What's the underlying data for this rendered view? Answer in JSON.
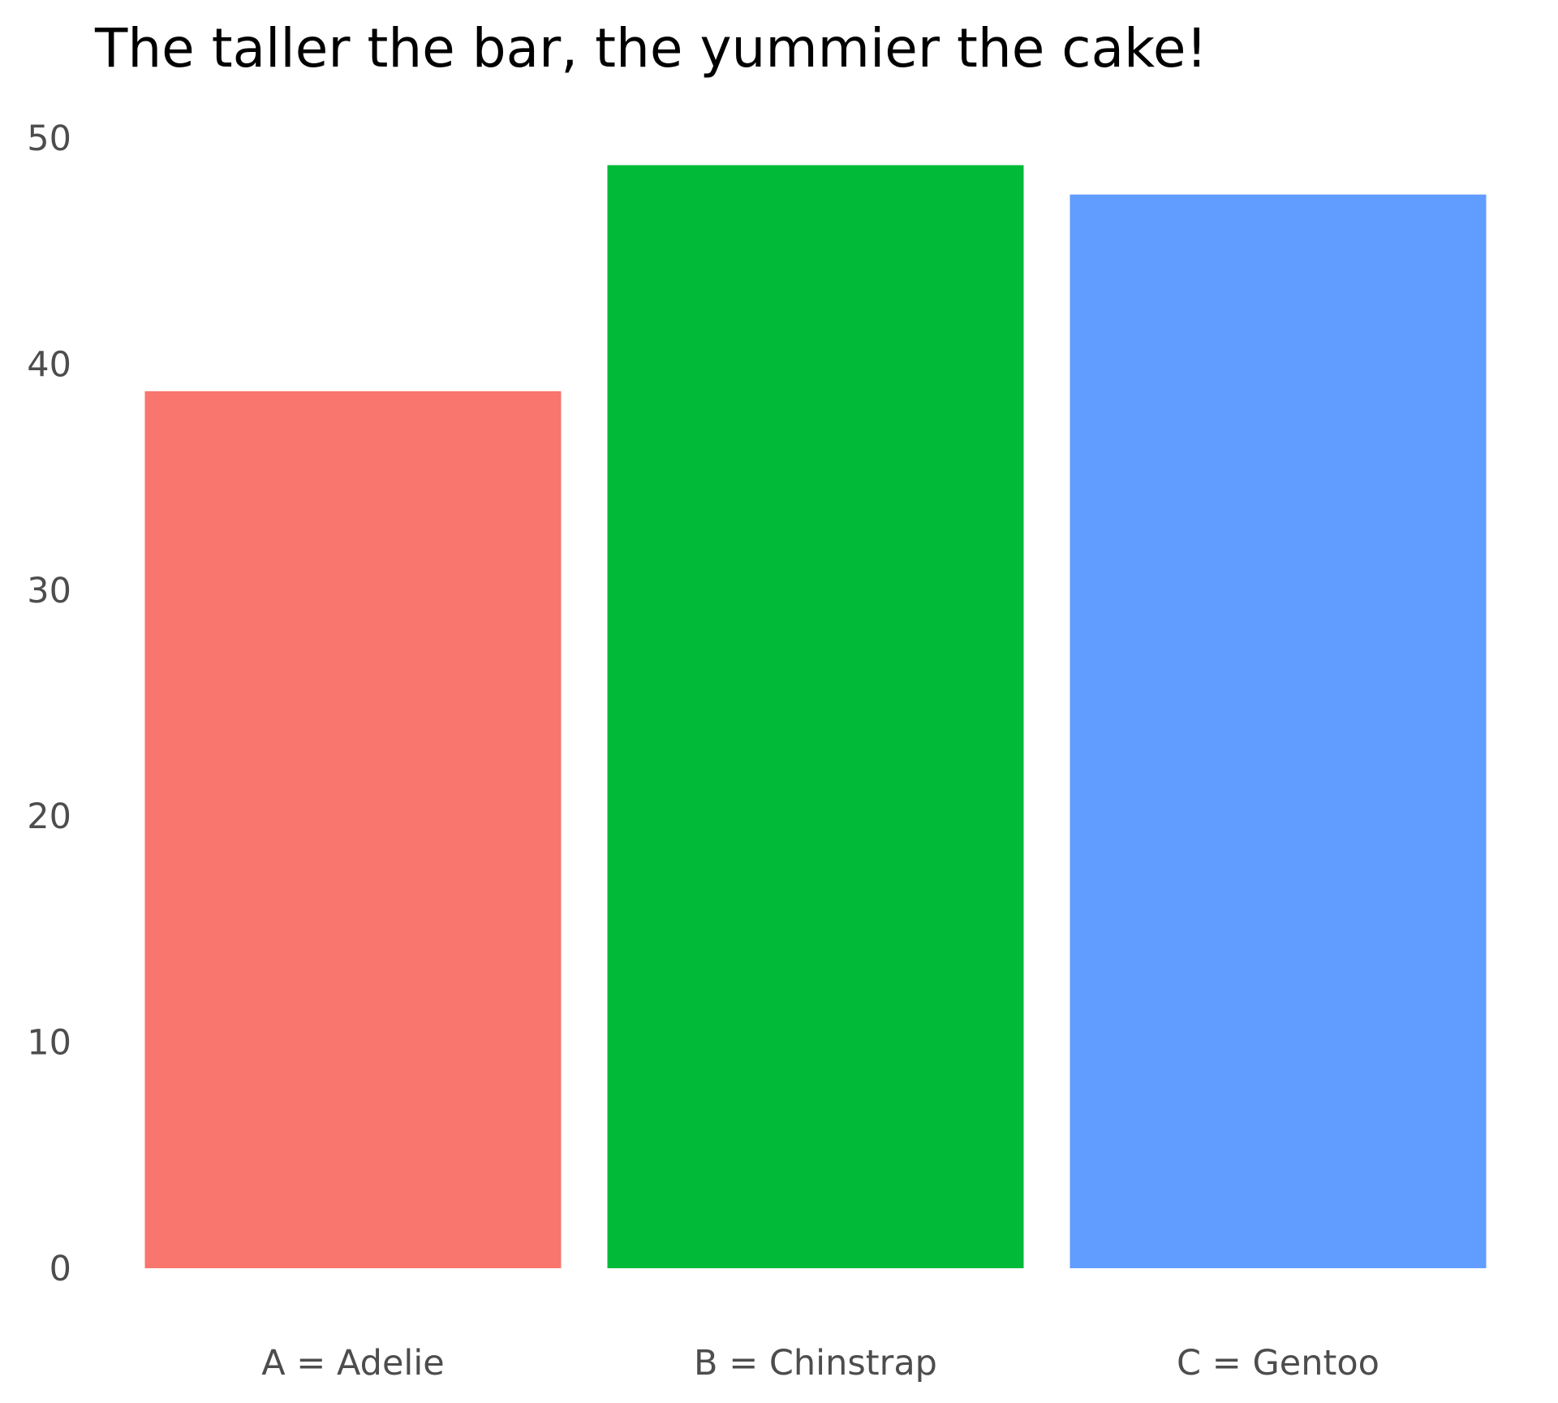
{
  "chart_data": {
    "type": "bar",
    "title": "The taller the bar, the yummier the cake!",
    "xlabel": "",
    "ylabel": "",
    "categories": [
      "A = Adelie",
      "B = Chinstrap",
      "C = Gentoo"
    ],
    "values": [
      38.8,
      48.8,
      47.5
    ],
    "colors": [
      "#F8766D",
      "#00BA38",
      "#619CFF"
    ],
    "ylim": [
      0,
      50
    ],
    "yticks": [
      "0",
      "10",
      "20",
      "30",
      "40",
      "50"
    ],
    "grid": false,
    "legend": "none"
  }
}
